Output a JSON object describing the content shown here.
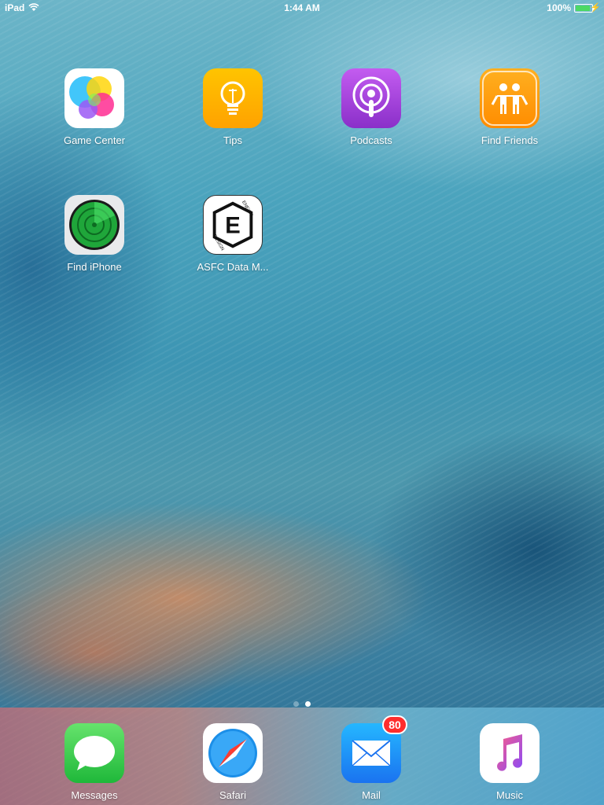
{
  "status_bar": {
    "carrier": "iPad",
    "time": "1:44 AM",
    "battery_percent": "100%",
    "battery_level": 1.0,
    "charging": true,
    "wifi_icon": "wifi-icon",
    "battery_color": "#4cd964"
  },
  "home": {
    "apps": [
      {
        "label": "Game Center",
        "icon": "game-center-icon"
      },
      {
        "label": "Tips",
        "icon": "tips-icon"
      },
      {
        "label": "Podcasts",
        "icon": "podcasts-icon"
      },
      {
        "label": "Find Friends",
        "icon": "find-friends-icon"
      },
      {
        "label": "Find iPhone",
        "icon": "find-iphone-icon"
      },
      {
        "label": "ASFC Data M...",
        "icon": "asfc-data-icon",
        "icon_text": "E",
        "logo_text_top": "ENEXTA",
        "logo_text_bottom": "DESIGN"
      }
    ]
  },
  "page_indicator": {
    "pages": 2,
    "current": 2
  },
  "dock": {
    "apps": [
      {
        "label": "Messages",
        "icon": "messages-icon"
      },
      {
        "label": "Safari",
        "icon": "safari-icon"
      },
      {
        "label": "Mail",
        "icon": "mail-icon",
        "badge": "80"
      },
      {
        "label": "Music",
        "icon": "music-icon"
      }
    ]
  },
  "colors": {
    "badge": "#ff2d2d",
    "tips": "#ffb800",
    "podcasts": "#a145d8",
    "find_friends": "#ff9f0a",
    "messages": "#34c759",
    "mail": "#1e8ef5"
  }
}
